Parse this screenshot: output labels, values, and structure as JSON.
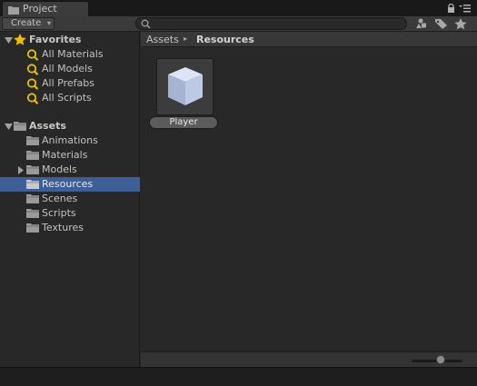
{
  "window": {
    "tab_title": "Project"
  },
  "toolbar": {
    "create_label": "Create",
    "search": {
      "value": "",
      "placeholder": ""
    }
  },
  "tree": {
    "favorites": {
      "label": "Favorites",
      "items": [
        {
          "label": "All Materials"
        },
        {
          "label": "All Models"
        },
        {
          "label": "All Prefabs"
        },
        {
          "label": "All Scripts"
        }
      ]
    },
    "assets": {
      "label": "Assets",
      "items": [
        {
          "label": "Animations",
          "selected": false,
          "has_children": false
        },
        {
          "label": "Materials",
          "selected": false,
          "has_children": false
        },
        {
          "label": "Models",
          "selected": false,
          "has_children": true
        },
        {
          "label": "Resources",
          "selected": true,
          "has_children": false
        },
        {
          "label": "Scenes",
          "selected": false,
          "has_children": false
        },
        {
          "label": "Scripts",
          "selected": false,
          "has_children": false
        },
        {
          "label": "Textures",
          "selected": false,
          "has_children": false
        }
      ]
    }
  },
  "breadcrumb": {
    "root": "Assets",
    "separator": "▸",
    "current": "Resources"
  },
  "assets_view": {
    "items": [
      {
        "name": "Player",
        "icon": "cube-prefab-icon"
      }
    ]
  },
  "colors": {
    "selection": "#3e5f96",
    "accent_star": "#f0c000",
    "search_icon": "#e8c000"
  }
}
